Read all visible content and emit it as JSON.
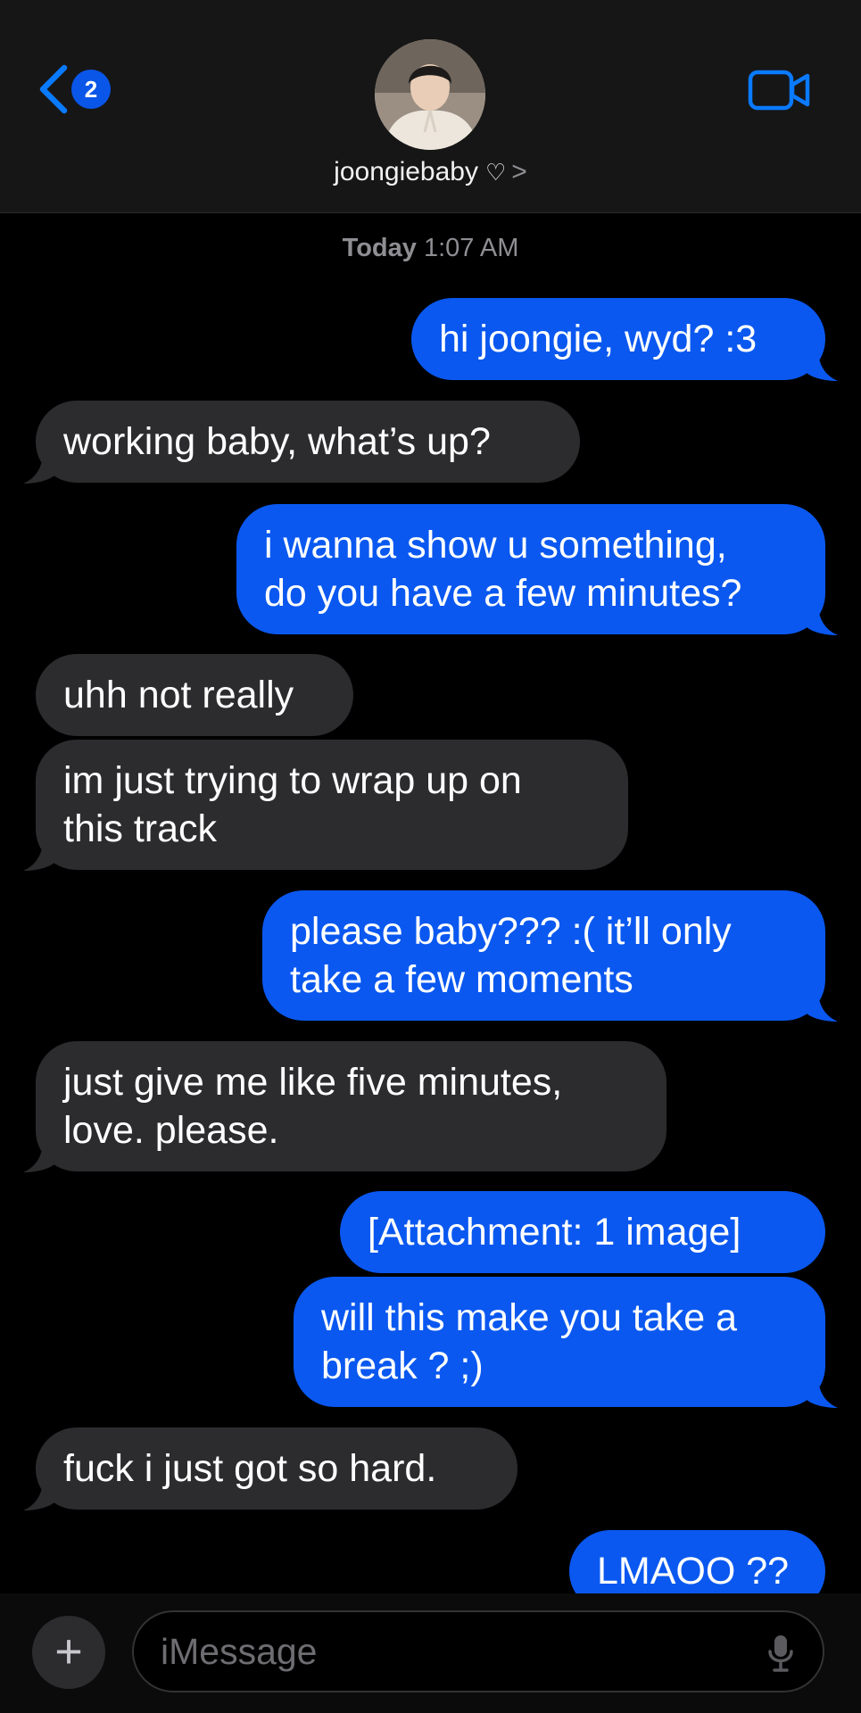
{
  "header": {
    "back_badge_count": "2",
    "contact_name": "joongiebaby",
    "contact_heart": "♡",
    "contact_chevron": ">"
  },
  "timestamp": {
    "day": "Today",
    "time": "1:07 AM"
  },
  "messages": [
    {
      "from": "me",
      "lines": [
        "hi joongie, wyd? :3"
      ]
    },
    {
      "from": "them",
      "lines": [
        "working baby, what’s up?"
      ]
    },
    {
      "from": "me",
      "lines": [
        "i wanna show u something,",
        "do you have a few minutes?"
      ]
    },
    {
      "from": "them",
      "lines": [
        "uhh not really"
      ]
    },
    {
      "from": "them",
      "lines": [
        "im just trying to wrap up on",
        "this track"
      ]
    },
    {
      "from": "me",
      "lines": [
        "please baby??? :( it’ll only",
        "take a few moments"
      ]
    },
    {
      "from": "them",
      "lines": [
        "just give me like five minutes,",
        "love. please."
      ]
    },
    {
      "from": "me",
      "lines": [
        "[Attachment: 1 image]"
      ]
    },
    {
      "from": "me",
      "lines": [
        "will this make you take a",
        "break ? ;)"
      ]
    },
    {
      "from": "them",
      "lines": [
        "fuck i just got so hard."
      ]
    },
    {
      "from": "me",
      "lines": [
        "LMAOO ??"
      ]
    }
  ],
  "input_bar": {
    "plus_label": "+",
    "placeholder": "iMessage"
  },
  "colors": {
    "sent_bubble": "#0a58f0",
    "received_bubble": "#2c2c2e",
    "accent": "#0a7aff",
    "background": "#000000"
  },
  "icons": {
    "back": "chevron-left-icon",
    "video": "video-camera-icon",
    "mic": "microphone-icon"
  }
}
